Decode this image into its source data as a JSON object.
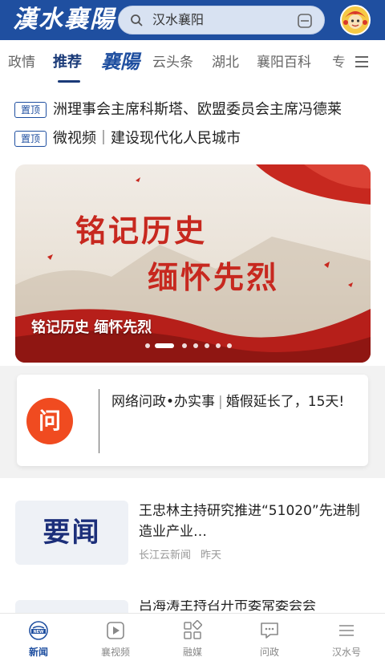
{
  "header": {
    "logo_text": "漢水襄陽",
    "search_placeholder": "汉水襄阳",
    "colors": {
      "primary": "#1f4fa0",
      "accent_red": "#c7281f",
      "wenzheng_orange": "#f04b20"
    }
  },
  "tabs": {
    "items": [
      {
        "label": "政情"
      },
      {
        "label": "推荐",
        "active": true
      },
      {
        "label": "襄陽",
        "brand": true
      },
      {
        "label": "云头条"
      },
      {
        "label": "湖北"
      },
      {
        "label": "襄阳百科"
      },
      {
        "label": "专"
      }
    ]
  },
  "pinned": {
    "badge": "置顶",
    "items": [
      {
        "title": "洲理事会主席科斯塔、欧盟委员会主席冯德莱"
      },
      {
        "title": "微视频｜建设现代化人民城市"
      }
    ]
  },
  "banner": {
    "line1": "铭记历史",
    "line2": "缅怀先烈",
    "caption": "铭记历史 缅怀先烈",
    "slide_count": 7,
    "active_slide": 2
  },
  "wenzheng": {
    "logo_char": "问",
    "source": "网络问政•办实事",
    "separator": "|",
    "text": "婚假延长了，15天!"
  },
  "news": [
    {
      "thumb_text": "要闻",
      "title": "王忠林主持研究推进“51020”先进制造业产业…",
      "source": "长江云新闻",
      "time": "昨天"
    },
    {
      "thumb_text": "",
      "title": "吕海涛主持召开市委常委会会",
      "source": "",
      "time": ""
    }
  ],
  "bottom_nav": {
    "items": [
      {
        "label": "新闻",
        "icon": "new-icon",
        "active": true
      },
      {
        "label": "襄视频",
        "icon": "video-play-icon"
      },
      {
        "label": "融媒",
        "icon": "grid-apps-icon"
      },
      {
        "label": "问政",
        "icon": "chat-bubble-icon"
      },
      {
        "label": "汉水号",
        "icon": "lines-icon"
      }
    ]
  }
}
